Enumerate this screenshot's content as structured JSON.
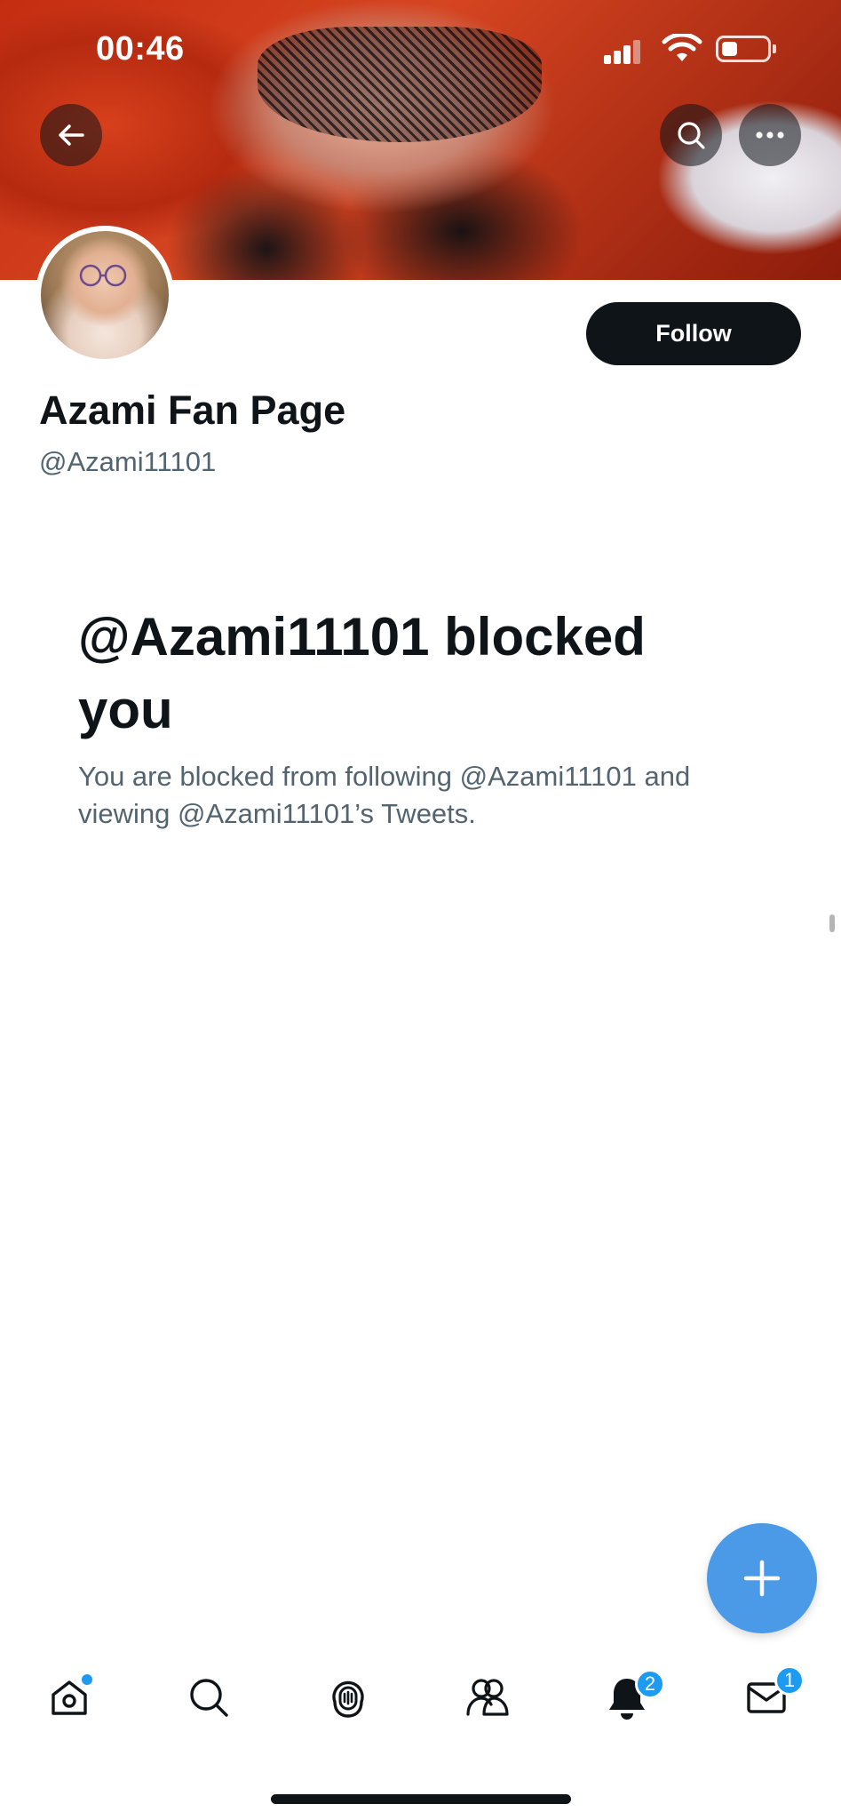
{
  "status_bar": {
    "time": "00:46",
    "battery_level": 0.35
  },
  "header": {
    "back_icon": "arrow-left-icon",
    "search_icon": "search-icon",
    "more_icon": "more-horizontal-icon"
  },
  "profile": {
    "display_name": "Azami Fan Page",
    "handle": "@Azami11101",
    "follow_label": "Follow"
  },
  "blocked": {
    "title": "@Azami11101 blocked you",
    "description": "You are blocked from following @Azami11101 and viewing @Azami11101’s Tweets."
  },
  "fab": {
    "icon": "plus-icon"
  },
  "tabbar": {
    "tabs": [
      {
        "name": "home",
        "icon": "home-icon",
        "has_dot": true
      },
      {
        "name": "search",
        "icon": "search-icon"
      },
      {
        "name": "spaces",
        "icon": "spaces-icon"
      },
      {
        "name": "communities",
        "icon": "communities-icon"
      },
      {
        "name": "notifications",
        "icon": "bell-icon",
        "badge": "2"
      },
      {
        "name": "messages",
        "icon": "envelope-icon",
        "badge": "1"
      }
    ]
  },
  "colors": {
    "primary_text": "#0f1419",
    "secondary_text": "#536471",
    "accent": "#1d9bf0",
    "fab": "#4a9ae8"
  }
}
